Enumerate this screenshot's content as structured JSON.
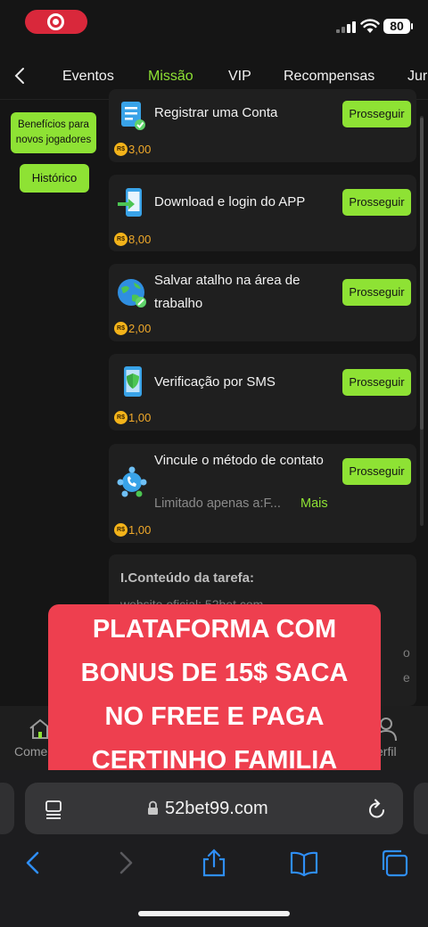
{
  "status_bar": {
    "battery": "80",
    "recording_icon": "record-icon",
    "signal_icon": "cellular-signal-icon",
    "wifi_icon": "wifi-icon"
  },
  "nav": {
    "back_icon": "chevron-left-icon",
    "tabs": [
      {
        "label": "Eventos"
      },
      {
        "label": "Missão"
      },
      {
        "label": "VIP"
      },
      {
        "label": "Recompensas"
      },
      {
        "label": "Jur"
      }
    ],
    "active_tab": "Missão",
    "accent_color": "#8ee234"
  },
  "sidebar": {
    "items": [
      {
        "label": "Benefícios para novos jogadores"
      },
      {
        "label": "Histórico"
      }
    ]
  },
  "tasks": [
    {
      "title": "Registrar uma Conta",
      "button": "Prosseguir",
      "currency": "R$",
      "reward": "3,00",
      "icon": "document-check-icon"
    },
    {
      "title": "Download e login do APP",
      "button": "Prosseguir",
      "currency": "R$",
      "reward": "8,00",
      "icon": "phone-download-icon"
    },
    {
      "title": "Salvar atalho na área de trabalho",
      "button": "Prosseguir",
      "currency": "R$",
      "reward": "2,00",
      "icon": "globe-link-icon"
    },
    {
      "title": "Verificação por SMS",
      "button": "Prosseguir",
      "currency": "R$",
      "reward": "1,00",
      "icon": "phone-shield-icon"
    },
    {
      "title": "Vincule o método de contato",
      "button": "Prosseguir",
      "currency": "R$",
      "reward": "1,00",
      "icon": "contact-network-icon",
      "limit": "Limitado apenas a:F...",
      "more": "Mais"
    }
  ],
  "task_content": {
    "title": "I.Conteúdo da tarefa:",
    "line": "website oficial: 52bet.com",
    "fragment_1": "o",
    "fragment_2": "e"
  },
  "bottom_nav": {
    "home_label": "Come",
    "profile_label": "erfil"
  },
  "banner": {
    "lines": [
      "PLATAFORMA COM",
      "BONUS DE 15$ SACA",
      "NO FREE E PAGA",
      "CERTINHO FAMILIA"
    ],
    "color": "#ee3f4f"
  },
  "browser": {
    "url": "52bet99.com",
    "toolbar_icons": [
      "back-icon",
      "forward-icon",
      "share-icon",
      "bookmarks-icon",
      "tabs-icon"
    ]
  }
}
